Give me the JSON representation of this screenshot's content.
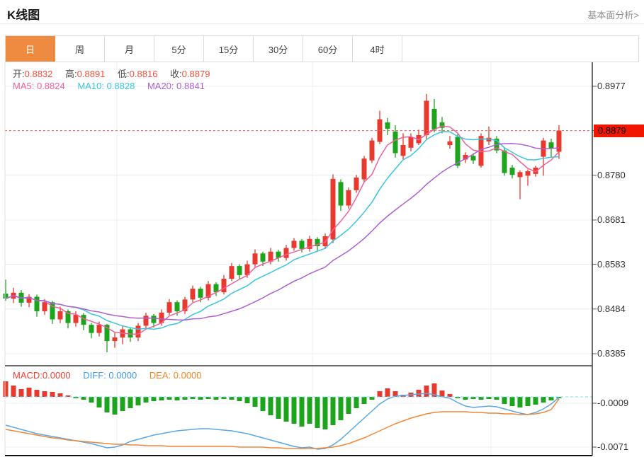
{
  "header": {
    "title": "K线图",
    "link_label": "基本面分析>"
  },
  "tabs": {
    "selected": "日",
    "items": [
      {
        "label": "日"
      },
      {
        "label": "周"
      },
      {
        "label": "月"
      },
      {
        "label": "5分"
      },
      {
        "label": "15分"
      },
      {
        "label": "30分"
      },
      {
        "label": "60分"
      },
      {
        "label": "4时"
      }
    ]
  },
  "legend": {
    "ohlc": [
      {
        "label": "开:",
        "value": "0.8832"
      },
      {
        "label": "高:",
        "value": "0.8891"
      },
      {
        "label": "低:",
        "value": "0.8816"
      },
      {
        "label": "收:",
        "value": "0.8879"
      }
    ],
    "ma": [
      {
        "label": "MA5:",
        "value": "0.8824",
        "color": "#F0609A"
      },
      {
        "label": "MA10:",
        "value": "0.8828",
        "color": "#38C6DE"
      },
      {
        "label": "MA20:",
        "value": "0.8841",
        "color": "#AE5FD0"
      }
    ]
  },
  "macd_legend": [
    {
      "label": "MACD:",
      "value": "0.0000",
      "color": "#F04134"
    },
    {
      "label": "DIFF:",
      "value": "0.0000",
      "color": "#3E9BF0"
    },
    {
      "label": "DEA:",
      "value": "0.0000",
      "color": "#F5861F"
    }
  ],
  "colors": {
    "up_candle": "#E8392E",
    "down_candle": "#1CA41C",
    "grid": "#E9EEF3",
    "vgrid": "#ECF1F6",
    "axis": "#3a3a3a",
    "current_price_line": "#F25C50",
    "current_price_box": "#F21500",
    "macd_zero_line": "#8ADAE8",
    "diff_line": "#58A8E8",
    "dea_line": "#F08838",
    "tab_accent": "#EE8B40"
  },
  "chart_data": {
    "type": "candlestick_with_macd",
    "price_axis": {
      "ticks": [
        "0.8977",
        "0.8879",
        "0.8780",
        "0.8681",
        "0.8583",
        "0.8484",
        "0.8385"
      ],
      "min": 0.8385,
      "max": 0.8977
    },
    "current_price": "0.8879",
    "ma_periods": [
      5,
      10,
      20
    ],
    "candles": [
      [
        0.8518,
        0.8549,
        0.8502,
        0.8507
      ],
      [
        0.8507,
        0.8531,
        0.8497,
        0.852
      ],
      [
        0.852,
        0.8526,
        0.8489,
        0.8498
      ],
      [
        0.8498,
        0.8517,
        0.8488,
        0.8511
      ],
      [
        0.8511,
        0.8516,
        0.8467,
        0.8479
      ],
      [
        0.8479,
        0.8506,
        0.8471,
        0.8499
      ],
      [
        0.8499,
        0.8502,
        0.8451,
        0.8461
      ],
      [
        0.8461,
        0.8489,
        0.8453,
        0.8479
      ],
      [
        0.8479,
        0.8483,
        0.8441,
        0.8453
      ],
      [
        0.8453,
        0.8479,
        0.8445,
        0.8471
      ],
      [
        0.8471,
        0.8475,
        0.8437,
        0.8449
      ],
      [
        0.8449,
        0.8453,
        0.8419,
        0.8431
      ],
      [
        0.8431,
        0.8456,
        0.8423,
        0.8449
      ],
      [
        0.8449,
        0.8451,
        0.8388,
        0.8413
      ],
      [
        0.8413,
        0.8431,
        0.8398,
        0.8421
      ],
      [
        0.8421,
        0.8446,
        0.8406,
        0.8439
      ],
      [
        0.8439,
        0.8443,
        0.8411,
        0.8421
      ],
      [
        0.8421,
        0.8453,
        0.8413,
        0.8447
      ],
      [
        0.8447,
        0.8476,
        0.8441,
        0.8469
      ],
      [
        0.8469,
        0.8473,
        0.8443,
        0.8453
      ],
      [
        0.8453,
        0.8483,
        0.8447,
        0.8476
      ],
      [
        0.8476,
        0.8506,
        0.8471,
        0.8499
      ],
      [
        0.8499,
        0.8503,
        0.8469,
        0.8479
      ],
      [
        0.8479,
        0.8511,
        0.8473,
        0.8505
      ],
      [
        0.8505,
        0.8536,
        0.8499,
        0.8529
      ],
      [
        0.8529,
        0.8533,
        0.8499,
        0.8509
      ],
      [
        0.8509,
        0.8546,
        0.8503,
        0.8539
      ],
      [
        0.8539,
        0.8543,
        0.8513,
        0.8521
      ],
      [
        0.8521,
        0.8559,
        0.8516,
        0.8551
      ],
      [
        0.8551,
        0.8586,
        0.8546,
        0.8579
      ],
      [
        0.8579,
        0.8583,
        0.8549,
        0.8559
      ],
      [
        0.8559,
        0.8591,
        0.8553,
        0.8583
      ],
      [
        0.8583,
        0.8616,
        0.8577,
        0.8607
      ],
      [
        0.8607,
        0.8611,
        0.8579,
        0.8589
      ],
      [
        0.8589,
        0.8619,
        0.8583,
        0.8611
      ],
      [
        0.8611,
        0.8615,
        0.8589,
        0.8597
      ],
      [
        0.8597,
        0.8626,
        0.8591,
        0.8619
      ],
      [
        0.8619,
        0.8641,
        0.8613,
        0.8635
      ],
      [
        0.8635,
        0.8639,
        0.8609,
        0.8617
      ],
      [
        0.8617,
        0.8646,
        0.8611,
        0.8639
      ],
      [
        0.8639,
        0.8643,
        0.8613,
        0.8623
      ],
      [
        0.8623,
        0.8651,
        0.8617,
        0.8645
      ],
      [
        0.8638,
        0.8782,
        0.863,
        0.8772
      ],
      [
        0.8765,
        0.8771,
        0.8701,
        0.8713
      ],
      [
        0.8713,
        0.8753,
        0.8706,
        0.8747
      ],
      [
        0.8747,
        0.8781,
        0.8741,
        0.8775
      ],
      [
        0.8771,
        0.8823,
        0.8765,
        0.8817
      ],
      [
        0.8813,
        0.8863,
        0.8807,
        0.8857
      ],
      [
        0.8854,
        0.8923,
        0.8849,
        0.8904
      ],
      [
        0.8897,
        0.8907,
        0.8869,
        0.8883
      ],
      [
        0.8877,
        0.8891,
        0.8819,
        0.8829
      ],
      [
        0.8823,
        0.8873,
        0.8815,
        0.8847
      ],
      [
        0.8841,
        0.8873,
        0.8833,
        0.8865
      ],
      [
        0.8851,
        0.8881,
        0.8847,
        0.8869
      ],
      [
        0.8869,
        0.896,
        0.8859,
        0.8945
      ],
      [
        0.8927,
        0.8949,
        0.8875,
        0.8881
      ],
      [
        0.8897,
        0.8909,
        0.8873,
        0.8885
      ],
      [
        0.8847,
        0.8867,
        0.8839,
        0.8855
      ],
      [
        0.8865,
        0.8871,
        0.8796,
        0.8801
      ],
      [
        0.8815,
        0.8831,
        0.8807,
        0.8825
      ],
      [
        0.8823,
        0.8829,
        0.8805,
        0.8813
      ],
      [
        0.8801,
        0.8873,
        0.8797,
        0.8867
      ],
      [
        0.8855,
        0.8888,
        0.8847,
        0.8863
      ],
      [
        0.8861,
        0.8867,
        0.8829,
        0.8835
      ],
      [
        0.8835,
        0.8841,
        0.8779,
        0.8785
      ],
      [
        0.8797,
        0.8803,
        0.8773,
        0.8781
      ],
      [
        0.8776,
        0.8791,
        0.8727,
        0.8787
      ],
      [
        0.8779,
        0.8793,
        0.8757,
        0.8789
      ],
      [
        0.8783,
        0.8801,
        0.8777,
        0.8797
      ],
      [
        0.8821,
        0.8863,
        0.8779,
        0.8857
      ],
      [
        0.8853,
        0.8861,
        0.8821,
        0.8839
      ],
      [
        0.8832,
        0.8891,
        0.8816,
        0.8879
      ]
    ],
    "macd": {
      "axis_ticks": [
        "-0.0009",
        "-0.0071"
      ],
      "unit": "1e-4",
      "hist": [
        22,
        16,
        11,
        13,
        10,
        8,
        7,
        5,
        2,
        -2,
        -4,
        -8,
        -15,
        -22,
        -25,
        -20,
        -16,
        -12,
        -8,
        -6,
        -5,
        -4,
        -5,
        -4,
        -3,
        -4,
        -3,
        -4,
        -3,
        -4,
        -6,
        -9,
        -14,
        -20,
        -26,
        -31,
        -35,
        -38,
        -42,
        -38,
        -44,
        -46,
        -40,
        -33,
        -24,
        -16,
        -10,
        -4,
        8,
        12,
        8,
        3,
        6,
        10,
        16,
        19,
        9,
        4,
        -2,
        -4,
        -3,
        -4,
        -3,
        -4,
        -10,
        -13,
        -15,
        -13,
        -11,
        -8,
        -5,
        -2
      ],
      "diff": [
        -40,
        -43,
        -46,
        -49,
        -52,
        -54,
        -56,
        -58,
        -60,
        -62,
        -64,
        -66,
        -69,
        -72,
        -71,
        -68,
        -63,
        -60,
        -57,
        -54,
        -52,
        -50,
        -48,
        -47,
        -46,
        -45,
        -45,
        -46,
        -47,
        -48,
        -50,
        -52,
        -55,
        -58,
        -61,
        -64,
        -67,
        -70,
        -72,
        -71,
        -74,
        -73,
        -68,
        -60,
        -50,
        -40,
        -30,
        -20,
        -10,
        -3,
        1,
        2,
        3,
        4,
        5,
        3,
        0,
        -2,
        -8,
        -13,
        -15,
        -14,
        -13,
        -14,
        -17,
        -20,
        -23,
        -25,
        -22,
        -17,
        -10,
        -1
      ],
      "dea": [
        -46,
        -48,
        -50,
        -52,
        -54,
        -56,
        -58,
        -59,
        -61,
        -62,
        -63,
        -64,
        -65,
        -66,
        -67,
        -67,
        -68,
        -68,
        -69,
        -69,
        -69,
        -70,
        -70,
        -70,
        -70,
        -70,
        -70,
        -70,
        -70,
        -70,
        -71,
        -71,
        -71,
        -71,
        -72,
        -72,
        -73,
        -73,
        -73,
        -73,
        -73,
        -72,
        -71,
        -69,
        -66,
        -62,
        -58,
        -53,
        -48,
        -43,
        -38,
        -34,
        -30,
        -27,
        -24,
        -22,
        -21,
        -21,
        -21,
        -21,
        -22,
        -22,
        -23,
        -23,
        -24,
        -24,
        -25,
        -25,
        -24,
        -22,
        -18,
        -3
      ]
    }
  }
}
